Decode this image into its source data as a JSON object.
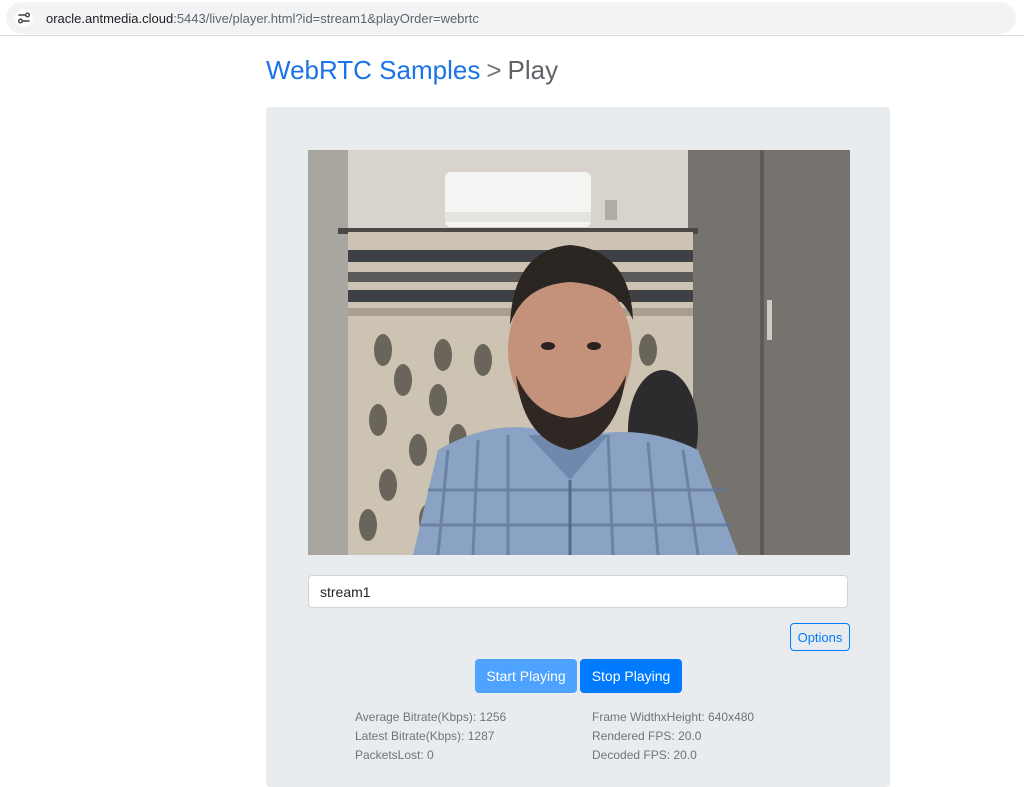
{
  "browser": {
    "url_host": "oracle.antmedia.cloud",
    "url_rest": ":5443/live/player.html?id=stream1&playOrder=webrtc"
  },
  "header": {
    "link": "WebRTC Samples",
    "separator": ">",
    "page": "Play"
  },
  "player": {
    "stream_id_value": "stream1",
    "options_label": "Options",
    "start_label": "Start Playing",
    "stop_label": "Stop Playing"
  },
  "stats": {
    "left": [
      {
        "label": "Average Bitrate(Kbps):",
        "value": "1256"
      },
      {
        "label": "Latest Bitrate(Kbps):",
        "value": "1287"
      },
      {
        "label": "PacketsLost:",
        "value": "0"
      }
    ],
    "right": [
      {
        "label": "Frame WidthxHeight:",
        "value": "640x480"
      },
      {
        "label": "Rendered FPS:",
        "value": "20.0"
      },
      {
        "label": "Decoded FPS:",
        "value": "20.0"
      }
    ]
  },
  "colors": {
    "link": "#1a73e8",
    "primary": "#007bff",
    "primary_light": "#4da3ff",
    "panel": "#e9ecef"
  }
}
